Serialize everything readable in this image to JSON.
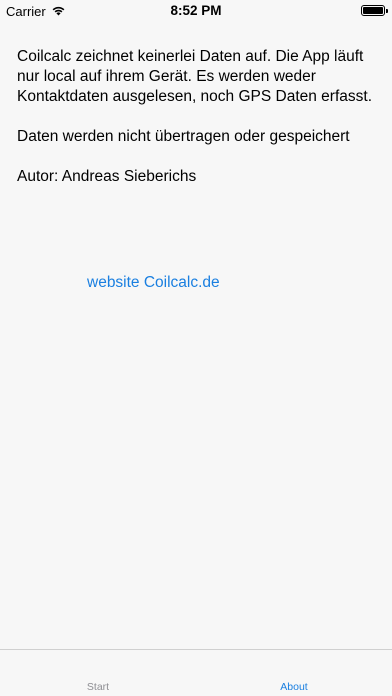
{
  "status_bar": {
    "carrier": "Carrier",
    "time": "8:52 PM"
  },
  "about": {
    "paragraphs": [
      "Coilcalc zeichnet keinerlei Daten auf. Die App läuft nur local auf ihrem Gerät. Es werden weder Kontaktdaten ausgelesen, noch GPS Daten erfasst.",
      "Daten werden nicht übertragen oder gespeichert",
      "Autor: Andreas Sieberichs"
    ],
    "website_link": "website Coilcalc.de"
  },
  "tab_bar": {
    "start_label": "Start",
    "about_label": "About",
    "active_color": "#1a7fe0",
    "inactive_color": "#8e8e93"
  }
}
